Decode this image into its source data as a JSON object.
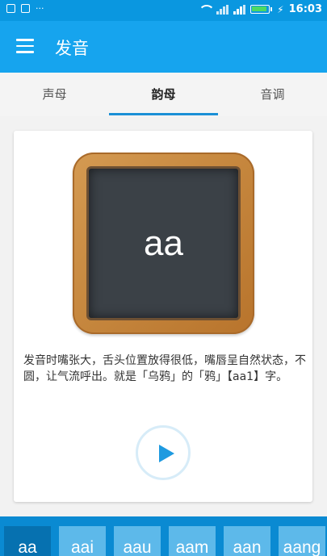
{
  "status_bar": {
    "left_icons": [
      "image-icon",
      "lock-icon"
    ],
    "dots": "···",
    "time": "16:03"
  },
  "app_bar": {
    "title": "发音",
    "menu_icon": "hamburger-menu-icon"
  },
  "tabs": [
    {
      "label": "声母",
      "selected": false
    },
    {
      "label": "韵母",
      "selected": true
    },
    {
      "label": "音调",
      "selected": false
    }
  ],
  "card": {
    "board_text": "aa",
    "description": "发音时嘴张大，舌头位置放得很低，嘴唇呈自然状态，不圆，让气流呼出。就是「乌鸦」的「鸦」【aa1】字。",
    "play_icon": "play-icon"
  },
  "bottom_keys": [
    {
      "label": "aa",
      "selected": true
    },
    {
      "label": "aai",
      "selected": false
    },
    {
      "label": "aau",
      "selected": false
    },
    {
      "label": "aam",
      "selected": false
    },
    {
      "label": "aan",
      "selected": false
    },
    {
      "label": "aang",
      "selected": false
    }
  ],
  "colors": {
    "status_bar": "#0a97e0",
    "app_bar": "#16a4ee",
    "tab_indicator": "#1a8fd6",
    "bottom_bar": "#0a8ad2",
    "key": "#5db9ea",
    "key_selected": "#0671b0"
  }
}
